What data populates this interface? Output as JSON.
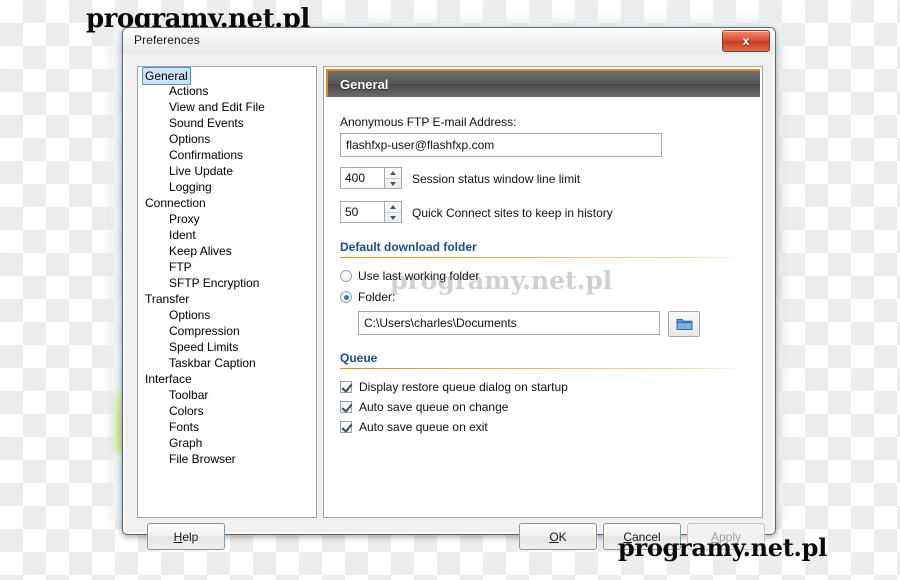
{
  "watermarks": {
    "top": "programy.net.pl",
    "bottom": "programy.net.pl",
    "center": "programy.net.pl"
  },
  "dialog": {
    "title": "Preferences",
    "close_label": "x"
  },
  "sidebar": {
    "items": [
      {
        "label": "General",
        "level": 0,
        "selected": true
      },
      {
        "label": "Actions",
        "level": 1,
        "selected": false
      },
      {
        "label": "View and Edit File",
        "level": 1,
        "selected": false
      },
      {
        "label": "Sound Events",
        "level": 1,
        "selected": false
      },
      {
        "label": "Options",
        "level": 1,
        "selected": false
      },
      {
        "label": "Confirmations",
        "level": 1,
        "selected": false
      },
      {
        "label": "Live Update",
        "level": 1,
        "selected": false
      },
      {
        "label": "Logging",
        "level": 1,
        "selected": false
      },
      {
        "label": "Connection",
        "level": 0,
        "selected": false
      },
      {
        "label": "Proxy",
        "level": 1,
        "selected": false
      },
      {
        "label": "Ident",
        "level": 1,
        "selected": false
      },
      {
        "label": "Keep Alives",
        "level": 1,
        "selected": false
      },
      {
        "label": "FTP",
        "level": 1,
        "selected": false
      },
      {
        "label": "SFTP Encryption",
        "level": 1,
        "selected": false
      },
      {
        "label": "Transfer",
        "level": 0,
        "selected": false
      },
      {
        "label": "Options",
        "level": 1,
        "selected": false
      },
      {
        "label": "Compression",
        "level": 1,
        "selected": false
      },
      {
        "label": "Speed Limits",
        "level": 1,
        "selected": false
      },
      {
        "label": "Taskbar Caption",
        "level": 1,
        "selected": false
      },
      {
        "label": "Interface",
        "level": 0,
        "selected": false
      },
      {
        "label": "Toolbar",
        "level": 1,
        "selected": false
      },
      {
        "label": "Colors",
        "level": 1,
        "selected": false
      },
      {
        "label": "Fonts",
        "level": 1,
        "selected": false
      },
      {
        "label": "Graph",
        "level": 1,
        "selected": false
      },
      {
        "label": "File Browser",
        "level": 1,
        "selected": false
      }
    ]
  },
  "panel": {
    "header": "General",
    "email": {
      "label": "Anonymous FTP E-mail Address:",
      "value": "flashfxp-user@flashfxp.com"
    },
    "session_lines": {
      "value": "400",
      "label": "Session status window line limit"
    },
    "quick_connect": {
      "value": "50",
      "label": "Quick Connect sites to keep in history"
    },
    "download_folder": {
      "group_title": "Default download folder",
      "option_last": "Use last working folder",
      "option_folder": "Folder:",
      "selected": "folder",
      "path": "C:\\Users\\charles\\Documents",
      "browse_icon": "folder-icon"
    },
    "queue": {
      "group_title": "Queue",
      "items": [
        {
          "label": "Display restore queue dialog on startup",
          "checked": true
        },
        {
          "label": "Auto save queue on change",
          "checked": true
        },
        {
          "label": "Auto save queue on exit",
          "checked": true
        }
      ]
    }
  },
  "footer": {
    "help": {
      "label": "Help",
      "accel": "H",
      "disabled": false
    },
    "ok": {
      "label": "OK",
      "accel": "O",
      "disabled": false
    },
    "cancel": {
      "label": "Cancel",
      "accel": "C",
      "disabled": false
    },
    "apply": {
      "label": "Apply",
      "accel": "A",
      "disabled": true
    }
  },
  "colors": {
    "accent_orange": "#e08a1e",
    "group_title_blue": "#1a4f8a",
    "selection_blue": "#cfe3f7",
    "close_red": "#d94f33",
    "folder_blue": "#3e86c4"
  }
}
